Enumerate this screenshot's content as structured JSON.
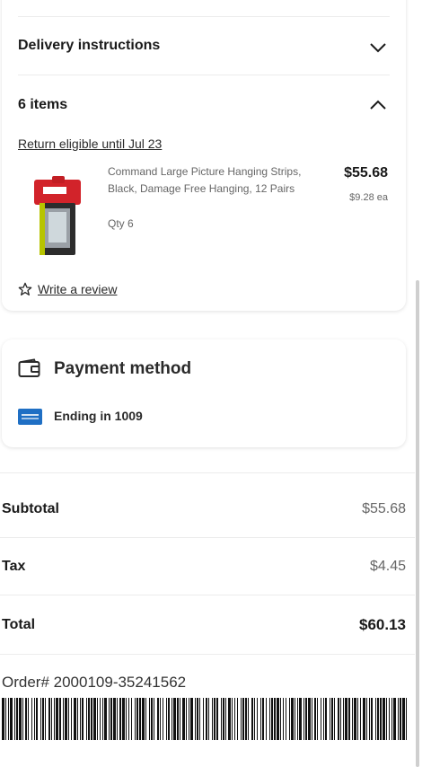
{
  "delivery": {
    "label": "Delivery instructions"
  },
  "items": {
    "header": "6 items",
    "return_text": "Return eligible until Jul 23",
    "product": {
      "title": "Command Large Picture Hanging Strips, Black, Damage Free Hanging, 12 Pairs",
      "qty": "Qty 6",
      "price": "$55.68",
      "each": "$9.28 ea"
    },
    "review_label": "Write a review"
  },
  "payment": {
    "title": "Payment method",
    "card_ending": "Ending in 1009"
  },
  "summary": {
    "subtotal_label": "Subtotal",
    "subtotal_value": "$55.68",
    "tax_label": "Tax",
    "tax_value": "$4.45",
    "total_label": "Total",
    "total_value": "$60.13"
  },
  "order": {
    "number": "Order# 2000109-35241562"
  },
  "colors": {
    "card_blue": "#1f6fc4",
    "link": "#2a2a2a"
  },
  "icons": {
    "delivery_toggle": "chevron-down-icon",
    "items_toggle": "chevron-up-icon",
    "review": "star-outline-icon",
    "payment": "wallet-icon",
    "card": "credit-card-icon"
  }
}
